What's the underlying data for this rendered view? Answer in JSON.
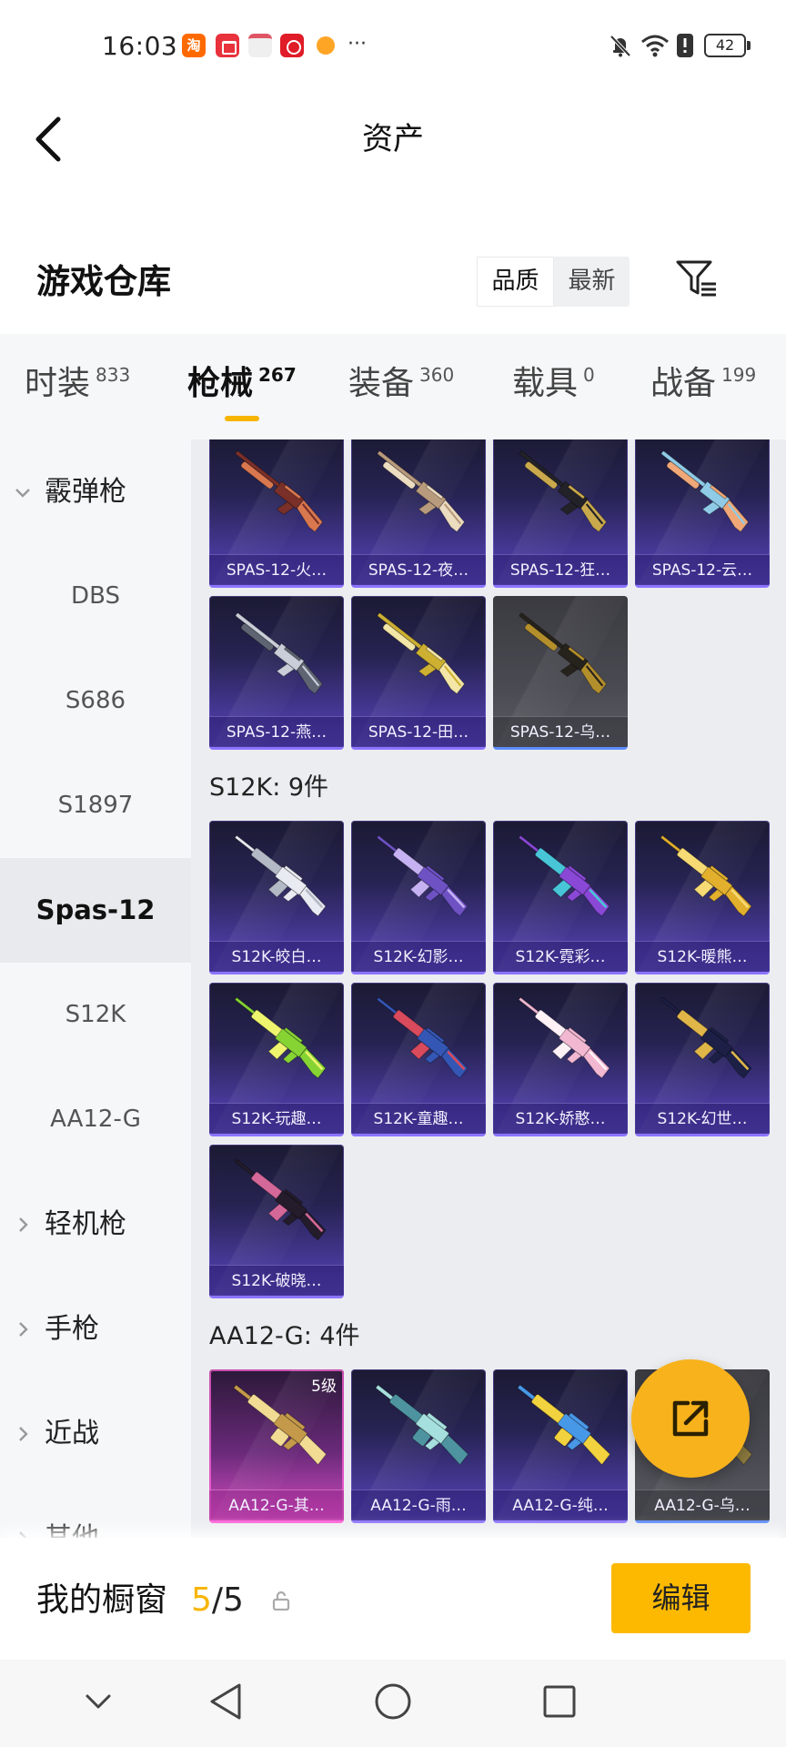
{
  "status_bar": {
    "time": "16:03",
    "taobao_glyph": "淘",
    "more": "···",
    "battery": "42",
    "icons": [
      "taobao-icon",
      "huawei-store-icon",
      "mail-app-icon",
      "red-app-icon",
      "orange-app-icon",
      "mute-bell-icon",
      "wifi-icon",
      "alert-icon",
      "battery-icon"
    ]
  },
  "header": {
    "title": "资产"
  },
  "warehouse": {
    "title": "游戏仓库",
    "sort": {
      "options": [
        {
          "label": "品质",
          "selected": true
        },
        {
          "label": "最新",
          "selected": false
        }
      ]
    }
  },
  "tabs": [
    {
      "label": "时装",
      "count": "833",
      "active": false
    },
    {
      "label": "枪械",
      "count": "267",
      "active": true
    },
    {
      "label": "装备",
      "count": "360",
      "active": false
    },
    {
      "label": "载具",
      "count": "0",
      "active": false
    },
    {
      "label": "战备",
      "count": "199",
      "active": false
    }
  ],
  "sidebar": {
    "items": [
      {
        "label": "霰弹枪",
        "type": "category",
        "expanded": true
      },
      {
        "label": "DBS",
        "type": "sub"
      },
      {
        "label": "S686",
        "type": "sub"
      },
      {
        "label": "S1897",
        "type": "sub"
      },
      {
        "label": "Spas-12",
        "type": "sub",
        "selected": true
      },
      {
        "label": "S12K",
        "type": "sub"
      },
      {
        "label": "AA12-G",
        "type": "sub"
      },
      {
        "label": "轻机枪",
        "type": "category",
        "expanded": false
      },
      {
        "label": "手枪",
        "type": "category",
        "expanded": false
      },
      {
        "label": "近战",
        "type": "category",
        "expanded": false
      },
      {
        "label": "其他",
        "type": "category",
        "expanded": false
      }
    ]
  },
  "inventory": {
    "groups": [
      {
        "gun_icon": "shotgun-icon",
        "items": [
          {
            "name": "SPAS-12-火…",
            "frame": "purple",
            "colors": [
              "#7a2f28",
              "#d9774f"
            ]
          },
          {
            "name": "SPAS-12-夜…",
            "frame": "purple",
            "colors": [
              "#b89a7c",
              "#ecdcc0"
            ]
          },
          {
            "name": "SPAS-12-狂…",
            "frame": "purple",
            "colors": [
              "#222228",
              "#c9a94c"
            ]
          },
          {
            "name": "SPAS-12-云…",
            "frame": "purple",
            "colors": [
              "#8fcbe6",
              "#f0a878"
            ]
          },
          {
            "name": "SPAS-12-燕…",
            "frame": "purple",
            "colors": [
              "#c9ced8",
              "#5e6472"
            ]
          },
          {
            "name": "SPAS-12-田…",
            "frame": "purple",
            "colors": [
              "#cdb032",
              "#f3e6a6"
            ]
          },
          {
            "name": "SPAS-12-乌…",
            "frame": "gray",
            "colors": [
              "#26221c",
              "#b38f2c"
            ]
          }
        ]
      },
      {
        "title": "S12K: 9件",
        "gun_icon": "rifle-icon",
        "items": [
          {
            "name": "S12K-皎白…",
            "frame": "purple",
            "colors": [
              "#e9ebf2",
              "#b4b9c6"
            ]
          },
          {
            "name": "S12K-幻影…",
            "frame": "purple",
            "colors": [
              "#6e52c4",
              "#c6b2f2"
            ]
          },
          {
            "name": "S12K-霓彩…",
            "frame": "purple",
            "colors": [
              "#8a48d6",
              "#48c6d8"
            ]
          },
          {
            "name": "S12K-暖熊…",
            "frame": "purple",
            "colors": [
              "#e2b02c",
              "#f6da74"
            ]
          },
          {
            "name": "S12K-玩趣…",
            "frame": "purple",
            "colors": [
              "#86d434",
              "#eef46e"
            ]
          },
          {
            "name": "S12K-童趣…",
            "frame": "purple",
            "colors": [
              "#3456b4",
              "#d84a5c"
            ]
          },
          {
            "name": "S12K-娇憨…",
            "frame": "purple",
            "colors": [
              "#f2b8d2",
              "#fff2f7"
            ]
          },
          {
            "name": "S12K-幻世…",
            "frame": "purple",
            "colors": [
              "#1c2046",
              "#e0b648"
            ]
          },
          {
            "name": "S12K-破晓…",
            "frame": "purple",
            "colors": [
              "#241c2a",
              "#d46898"
            ]
          }
        ]
      },
      {
        "title": "AA12-G: 4件",
        "gun_icon": "aa12-icon",
        "items": [
          {
            "name": "AA12-G-其…",
            "frame": "pink",
            "badge": "5级",
            "colors": [
              "#c49a4a",
              "#f2dc94"
            ]
          },
          {
            "name": "AA12-G-雨…",
            "frame": "purple",
            "colors": [
              "#a6e0de",
              "#4e94a0"
            ]
          },
          {
            "name": "AA12-G-纯…",
            "frame": "purple",
            "colors": [
              "#4898e8",
              "#f2d23e"
            ]
          },
          {
            "name": "AA12-G-乌…",
            "frame": "gray",
            "colors": [
              "#26221c",
              "#8c7a3e"
            ]
          }
        ]
      }
    ]
  },
  "showcase": {
    "label": "我的橱窗",
    "count": "5",
    "total_text": "/5",
    "edit_label": "编辑"
  },
  "colors": {
    "accent": "#f7b500",
    "edit_button": "#fcb900",
    "float_button": "#f8b21c",
    "frame_purple": "#8c74ff",
    "frame_gray_border": "#5d8cff",
    "frame_pink": "#ff62d8"
  }
}
